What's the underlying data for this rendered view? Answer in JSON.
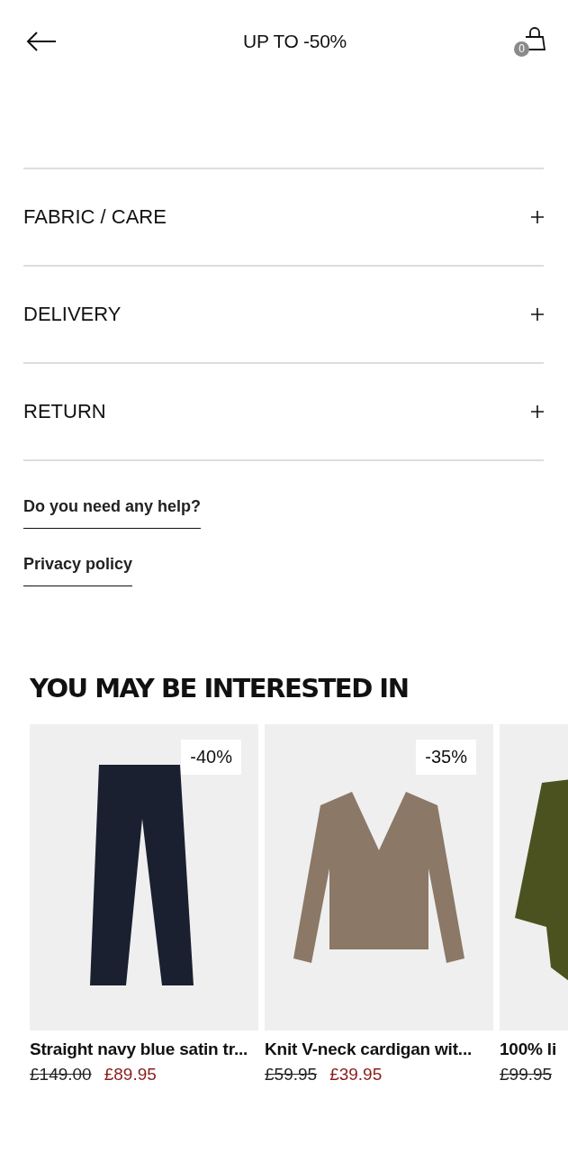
{
  "header": {
    "title": "UP TO -50%",
    "cart_count": "0"
  },
  "accordion": [
    {
      "label": "FABRIC / CARE",
      "expanded": false
    },
    {
      "label": "DELIVERY",
      "expanded": false
    },
    {
      "label": "RETURN",
      "expanded": false
    }
  ],
  "links": [
    "Do you need any help?",
    "Privacy policy"
  ],
  "recommendations": {
    "title": "YOU MAY BE INTERESTED IN",
    "products": [
      {
        "kind": "trousers",
        "badge": "-40%",
        "name": "Straight navy blue satin tr...",
        "old_price": "£149.00",
        "price": "£89.95"
      },
      {
        "kind": "cardigan",
        "badge": "-35%",
        "name": "Knit V-neck cardigan wit...",
        "old_price": "£59.95",
        "price": "£39.95"
      },
      {
        "kind": "shirt",
        "name": "100% li",
        "old_price": "£99.95"
      }
    ]
  }
}
